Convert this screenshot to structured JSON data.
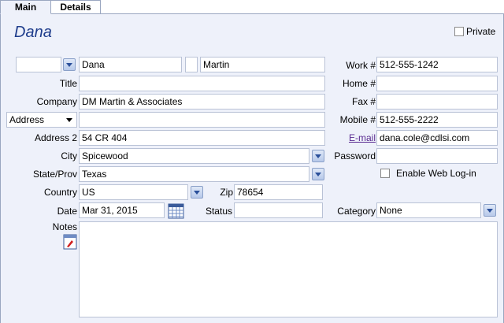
{
  "tabs": [
    {
      "label": "Main",
      "active": true
    },
    {
      "label": "Details",
      "active": false
    }
  ],
  "contact": {
    "display_name": "Dana"
  },
  "private": {
    "label": "Private",
    "checked": false
  },
  "name": {
    "prefix": "",
    "first": "Dana",
    "middle": "",
    "last": "Martin"
  },
  "labels": {
    "title": "Title",
    "company": "Company",
    "address2": "Address 2",
    "city": "City",
    "state": "State/Prov",
    "country": "Country",
    "zip": "Zip",
    "date": "Date",
    "status": "Status",
    "notes": "Notes",
    "work": "Work #",
    "home": "Home #",
    "fax": "Fax #",
    "mobile": "Mobile #",
    "email": "E-mail",
    "password": "Password",
    "category": "Category"
  },
  "fields": {
    "title": "",
    "company": "DM Martin & Associates",
    "address_type": "Address",
    "address1": "",
    "address2": "54 CR 404",
    "city": "Spicewood",
    "state": "Texas",
    "country": "US",
    "zip": "78654",
    "date": "Mar 31, 2015",
    "status": "",
    "notes": "",
    "work": "512-555-1242",
    "home": "",
    "fax": "",
    "mobile": "512-555-2222",
    "email": "dana.cole@cdlsi.com",
    "password": "",
    "category": "None"
  },
  "web_login": {
    "label": "Enable Web Log-in",
    "checked": false
  },
  "colors": {
    "accent": "#1f3d8c",
    "panel": "#eef1fa",
    "link": "#5a2c91"
  }
}
